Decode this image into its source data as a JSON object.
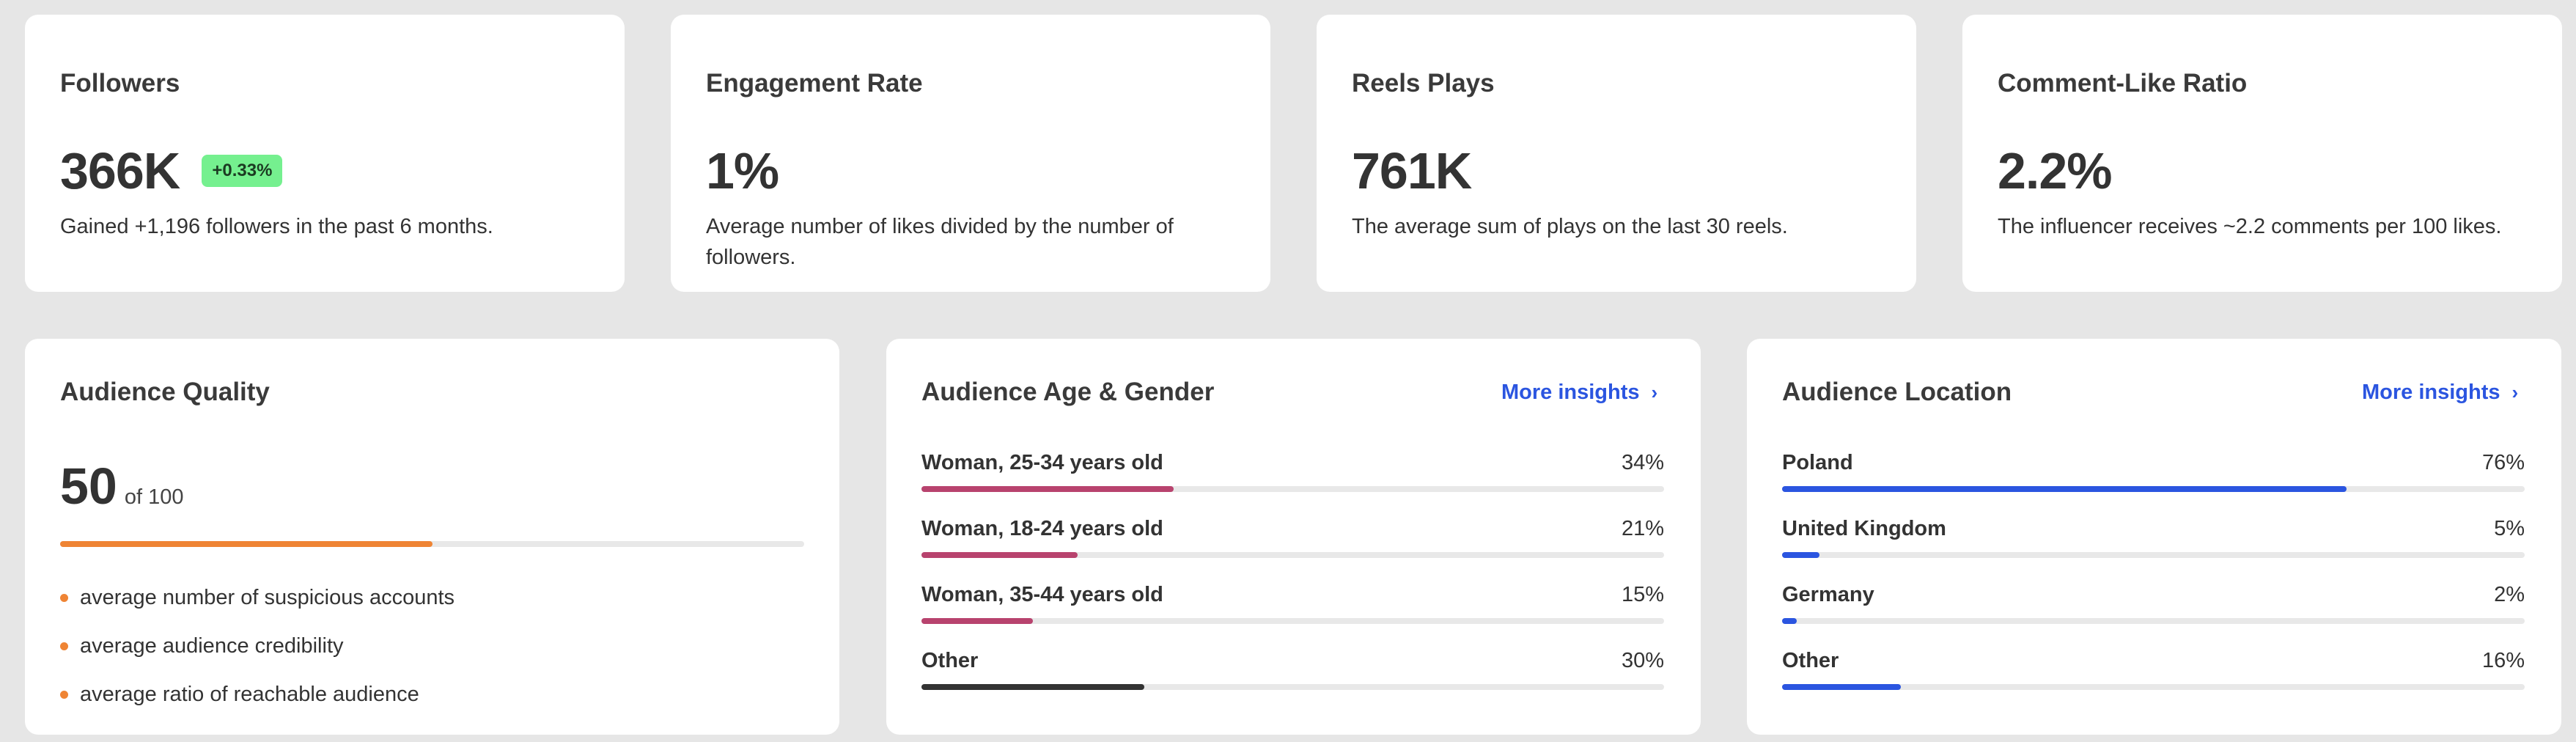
{
  "stats": [
    {
      "title": "Followers",
      "value": "366K",
      "badge": "+0.33%",
      "desc": "Gained +1,196 followers in the past 6 months."
    },
    {
      "title": "Engagement Rate",
      "value": "1%",
      "desc": "Average number of likes divided by the number of followers."
    },
    {
      "title": "Reels Plays",
      "value": "761K",
      "desc": "The average sum of plays on the last 30 reels."
    },
    {
      "title": "Comment-Like Ratio",
      "value": "2.2%",
      "desc": "The influencer receives ~2.2 comments per 100 likes."
    }
  ],
  "audience_quality": {
    "title": "Audience Quality",
    "value": "50",
    "of": "of 100",
    "score_fraction": 0.5,
    "bar_color": "#ef8434",
    "bullets": [
      "average number of suspicious accounts",
      "average audience credibility",
      "average ratio of reachable audience"
    ]
  },
  "age_gender": {
    "title": "Audience Age & Gender",
    "more": "More insights",
    "rows": [
      {
        "label": "Woman, 25-34 years old",
        "pct": "34%",
        "fraction": 0.34,
        "color": "#b8436e"
      },
      {
        "label": "Woman, 18-24 years old",
        "pct": "21%",
        "fraction": 0.21,
        "color": "#b8436e"
      },
      {
        "label": "Woman, 35-44 years old",
        "pct": "15%",
        "fraction": 0.15,
        "color": "#b8436e"
      },
      {
        "label": "Other",
        "pct": "30%",
        "fraction": 0.3,
        "color": "#333333"
      }
    ]
  },
  "location": {
    "title": "Audience Location",
    "more": "More insights",
    "rows": [
      {
        "label": "Poland",
        "pct": "76%",
        "fraction": 0.76,
        "color": "#2b55e0"
      },
      {
        "label": "United Kingdom",
        "pct": "5%",
        "fraction": 0.05,
        "color": "#2b55e0"
      },
      {
        "label": "Germany",
        "pct": "2%",
        "fraction": 0.02,
        "color": "#2b55e0"
      },
      {
        "label": "Other",
        "pct": "16%",
        "fraction": 0.16,
        "color": "#2b55e0"
      }
    ]
  }
}
